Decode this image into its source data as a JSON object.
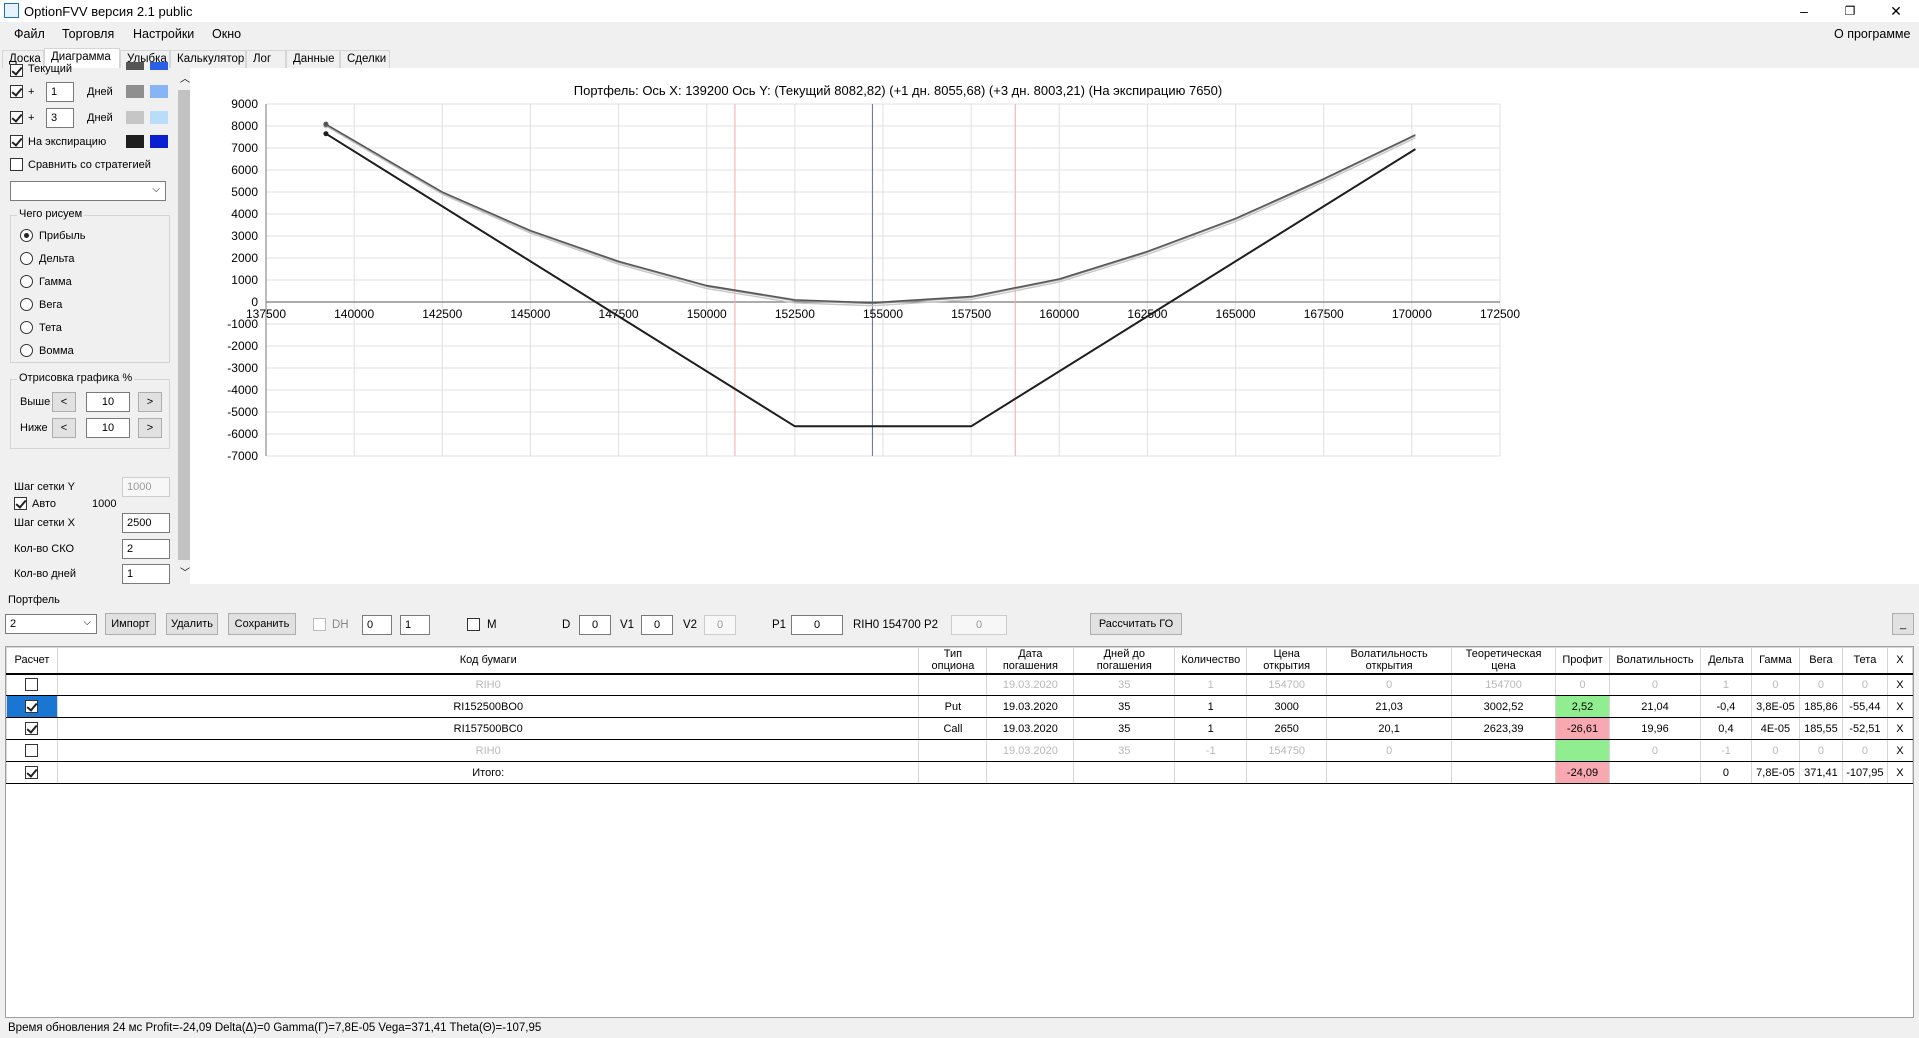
{
  "window": {
    "title": "OptionFVV версия 2.1 public",
    "minimize": "–",
    "maximize": "❐",
    "close": "✕"
  },
  "menu": {
    "items": [
      "Файл",
      "Торговля",
      "Настройки",
      "Окно"
    ],
    "about": "О программе"
  },
  "tabs": [
    "Доска",
    "Диаграмма",
    "Улыбка",
    "Калькулятор",
    "Лог",
    "Данные",
    "Сделки"
  ],
  "active_tab": "Диаграмма",
  "left_panel": {
    "current_label": "Текущий",
    "plus": "+",
    "days_label": "Дней",
    "row1_days": "1",
    "row2_days": "3",
    "expiry_label": "На экспирацию",
    "compare_label": "Сравнить со стратегией",
    "draw_group_title": "Чего рисуем",
    "draw_options": [
      "Прибыль",
      "Дельта",
      "Гамма",
      "Вега",
      "Тета",
      "Вомма"
    ],
    "draw_selected": "Прибыль",
    "render_group_title": "Отрисовка графика %",
    "above_label": "Выше",
    "above_value": "10",
    "below_label": "Ниже",
    "below_value": "10",
    "btn_left": "<",
    "btn_right": ">",
    "grid_y_label": "Шаг сетки Y",
    "grid_y_value": "1000",
    "auto_label": "Авто",
    "auto_value": "1000",
    "grid_x_label": "Шаг сетки X",
    "grid_x_value": "2500",
    "sko_label": "Кол-во СКО",
    "sko_value": "2",
    "days_count_label": "Кол-во дней",
    "days_count_value": "1",
    "colors": {
      "current_a": "#555555",
      "current_b": "#2b5fe8",
      "day1_a": "#8f8f8f",
      "day1_b": "#86b4f5",
      "day3_a": "#c6c6c6",
      "day3_b": "#b9dcf9",
      "expiry_a": "#1e1e1e",
      "expiry_b": "#0a1fd0"
    }
  },
  "chart_data": {
    "type": "line",
    "title": "Портфель: Ось X:  139200 Ось Y:   (Текущий 8082,82)  (+1 дн. 8055,68)  (+3 дн. 8003,21)  (На экспирацию 7650)",
    "xlim": [
      137500,
      172500
    ],
    "ylim": [
      -7000,
      9000
    ],
    "x_ticks": [
      137500,
      140000,
      142500,
      145000,
      147500,
      150000,
      152500,
      155000,
      157500,
      160000,
      162500,
      165000,
      167500,
      170000,
      172500
    ],
    "y_ticks": [
      9000,
      8000,
      7000,
      6000,
      5000,
      4000,
      3000,
      2000,
      1000,
      0,
      -1000,
      -2000,
      -3000,
      -4000,
      -5000,
      -6000,
      -7000
    ],
    "grid": true,
    "crosshair_x": 154700,
    "sko_lines_x": [
      150800,
      158750
    ],
    "series": [
      {
        "color": "#1e1e1e",
        "x": [
          139200,
          152500,
          157500,
          170100
        ],
        "y": [
          7650,
          -5650,
          -5650,
          6950
        ]
      },
      {
        "color": "#555555",
        "x": [
          139200,
          142500,
          145000,
          147500,
          150000,
          152500,
          154700,
          157500,
          160000,
          162500,
          165000,
          167500,
          170100
        ],
        "y": [
          8083,
          5000,
          3250,
          1850,
          750,
          100,
          -30,
          250,
          1050,
          2300,
          3800,
          5600,
          7600
        ]
      },
      {
        "color": "#8f8f8f",
        "x": [
          139200,
          142500,
          145000,
          147500,
          150000,
          152500,
          154700,
          157500,
          160000,
          162500,
          165000,
          167500,
          170100
        ],
        "y": [
          8056,
          4970,
          3210,
          1810,
          710,
          60,
          -70,
          210,
          1010,
          2260,
          3760,
          5560,
          7560
        ]
      },
      {
        "color": "#c6c6c6",
        "x": [
          139200,
          142500,
          145000,
          147500,
          150000,
          152500,
          154700,
          157500,
          160000,
          162500,
          165000,
          167500,
          170100
        ],
        "y": [
          8003,
          4900,
          3130,
          1720,
          610,
          -40,
          -170,
          110,
          910,
          2160,
          3660,
          5460,
          7460
        ]
      }
    ]
  },
  "portfolio": {
    "section_label": "Портфель",
    "select_value": "2",
    "import_btn": "Импорт",
    "delete_btn": "Удалить",
    "save_btn": "Сохранить",
    "dh_label": "DH",
    "spin1": "0",
    "spin2": "1",
    "m_label": "M",
    "d_label": "D",
    "d_value": "0",
    "v1_label": "V1",
    "v1_value": "0",
    "v2_label": "V2",
    "v2_value": "0",
    "p1_label": "P1",
    "p1_value": "0",
    "rih_label": "RIH0 154700",
    "p2_label": "P2",
    "p2_value": "0",
    "calc_btn": "Рассчитать ГО",
    "minimize_btn": "_"
  },
  "table": {
    "headers": [
      "Расчет",
      "Код бумаги",
      "Тип опциона",
      "Дата погашения",
      "Дней до погашения",
      "Количество",
      "Цена открытия",
      "Волатильность открытия",
      "Теоретическая цена",
      "Профит",
      "Волатильность",
      "Дельта",
      "Гамма",
      "Вега",
      "Тета",
      "X"
    ],
    "rows": [
      {
        "checked": false,
        "grey": true,
        "cells": [
          "RIH0",
          "",
          "19.03.2020",
          "35",
          "1",
          "154700",
          "0",
          "154700",
          "0",
          "0",
          "1",
          "0",
          "0",
          "0",
          "X"
        ],
        "profit_bg": ""
      },
      {
        "checked": true,
        "selected": true,
        "grey": false,
        "cells": [
          "RI152500BO0",
          "Put",
          "19.03.2020",
          "35",
          "1",
          "3000",
          "21,03",
          "3002,52",
          "2,52",
          "21,04",
          "-0,4",
          "3,8E-05",
          "185,86",
          "-55,44",
          "X"
        ],
        "profit_bg": "pgreen"
      },
      {
        "checked": true,
        "grey": false,
        "cells": [
          "RI157500BC0",
          "Call",
          "19.03.2020",
          "35",
          "1",
          "2650",
          "20,1",
          "2623,39",
          "-26,61",
          "19,96",
          "0,4",
          "4E-05",
          "185,55",
          "-52,51",
          "X"
        ],
        "profit_bg": "pred"
      },
      {
        "checked": false,
        "grey": true,
        "cells": [
          "RIH0",
          "",
          "19.03.2020",
          "35",
          "-1",
          "154750",
          "0",
          "",
          "",
          "0",
          "-1",
          "0",
          "0",
          "0",
          "X"
        ],
        "profit_bg": "pgreen"
      },
      {
        "checked": true,
        "grey": false,
        "cells": [
          "Итого:",
          "",
          "",
          "",
          "",
          "",
          "",
          "",
          "-24,09",
          "",
          "0",
          "7,8E-05",
          "371,41",
          "-107,95",
          "X"
        ],
        "profit_bg": "pred"
      }
    ]
  },
  "status": "Время обновления 24 мс  Profit=-24,09 Delta(Δ)=0 Gamma(Γ)=7,8E-05 Vega=371,41 Theta(Θ)=-107,95"
}
